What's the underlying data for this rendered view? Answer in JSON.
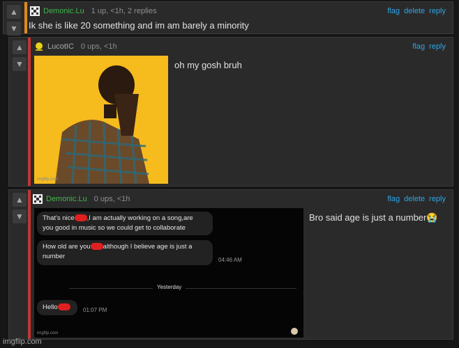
{
  "actions": {
    "flag": "flag",
    "delete": "delete",
    "reply": "reply"
  },
  "comments": [
    {
      "username": "Demonic.Lu",
      "meta": "1 up, <1h, 2 replies",
      "text": "Ik she is like 20 something and im am barely a minority"
    },
    {
      "username": "LucotIC",
      "meta": "0 ups, <1h",
      "text": "oh my gosh bruh",
      "image_watermark": "imgflip.com"
    },
    {
      "username": "Demonic.Lu",
      "meta": "0 ups, <1h",
      "text": "Bro said age is just a number",
      "emoji": "😭",
      "screenshot": {
        "msg1_a": "That's nice",
        "msg1_b": ",I am actually working on a song,are",
        "msg1_c": "you good in music so we could get to collaborate",
        "msg2_a": "How old are you",
        "msg2_b": "although I believe age is just a",
        "msg2_c": "number",
        "time1": "04:46 AM",
        "separator": "Yesterday",
        "msg3": "Hello",
        "time2": "01:07 PM",
        "watermark": "imgflip.com"
      }
    }
  ],
  "footer_watermark": "imgflip.com",
  "colors": {
    "link": "#2ea6e8",
    "username": "#3fb948",
    "op_bar": "#e08a1f",
    "reply_bar": "#c23535"
  }
}
